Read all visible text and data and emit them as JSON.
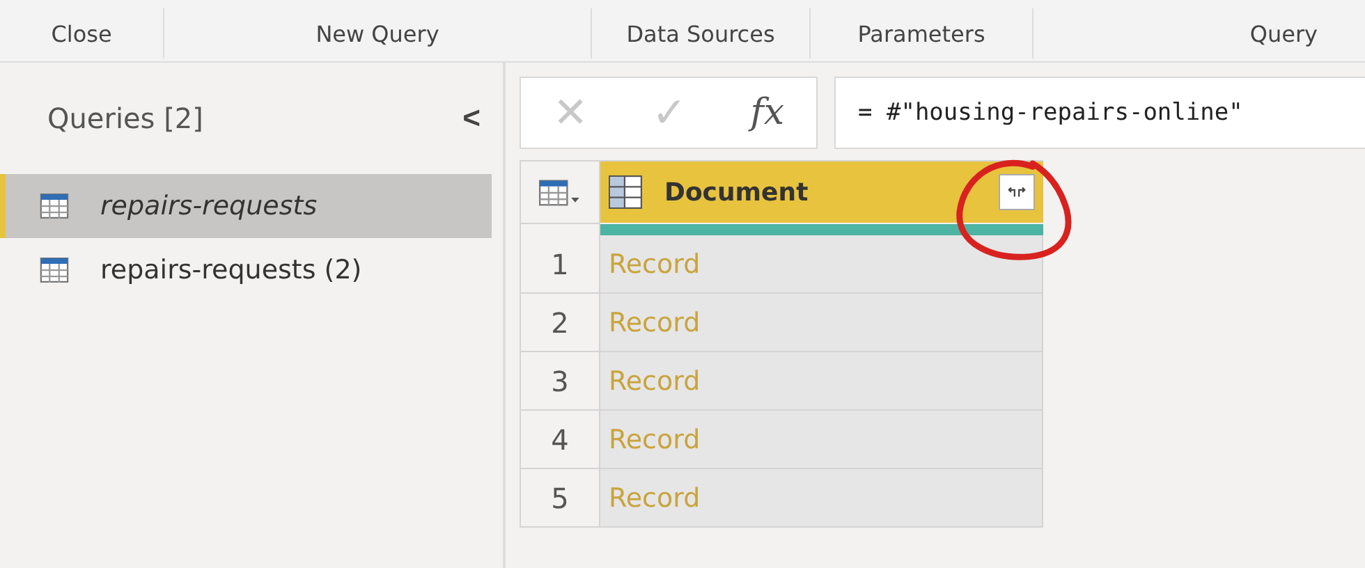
{
  "ribbon_groups": [
    "Close",
    "New Query",
    "Data Sources",
    "Parameters",
    "Query"
  ],
  "queries_pane": {
    "title": "Queries [2]",
    "collapse_glyph": "<",
    "items": [
      {
        "label": "repairs-requests",
        "selected": true
      },
      {
        "label": "repairs-requests (2)",
        "selected": false
      }
    ]
  },
  "formula_bar": {
    "cancel_glyph": "✕",
    "commit_glyph": "✓",
    "fx_glyph": "fx",
    "formula": "= #\"housing-repairs-online\""
  },
  "table": {
    "columns": [
      "Document"
    ],
    "rows": [
      {
        "number": "1",
        "cells": [
          "Record"
        ]
      },
      {
        "number": "2",
        "cells": [
          "Record"
        ]
      },
      {
        "number": "3",
        "cells": [
          "Record"
        ]
      },
      {
        "number": "4",
        "cells": [
          "Record"
        ]
      },
      {
        "number": "5",
        "cells": [
          "Record"
        ]
      }
    ]
  }
}
